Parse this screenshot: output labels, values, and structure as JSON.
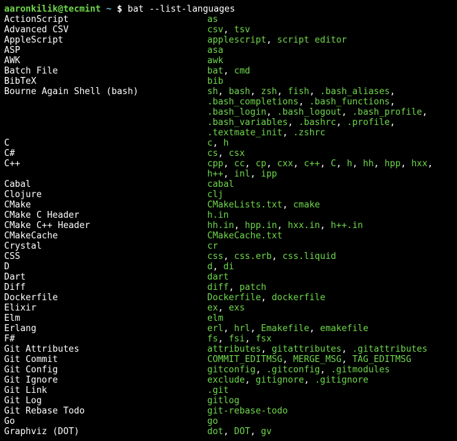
{
  "prompt": {
    "user": "aaronkilik@tecmint",
    "tilde": "~",
    "dollar": "$",
    "command": "bat --list-languages"
  },
  "rows": [
    {
      "lang": "ActionScript",
      "exts": [
        "as"
      ]
    },
    {
      "lang": "Advanced CSV",
      "exts": [
        "csv",
        "tsv"
      ]
    },
    {
      "lang": "AppleScript",
      "exts": [
        "applescript",
        "script editor"
      ]
    },
    {
      "lang": "ASP",
      "exts": [
        "asa"
      ]
    },
    {
      "lang": "AWK",
      "exts": [
        "awk"
      ]
    },
    {
      "lang": "Batch File",
      "exts": [
        "bat",
        "cmd"
      ]
    },
    {
      "lang": "BibTeX",
      "exts": [
        "bib"
      ]
    },
    {
      "lang": "Bourne Again Shell (bash)",
      "exts": [
        "sh",
        "bash",
        "zsh",
        "fish",
        ".bash_aliases",
        ".bash_completions",
        ".bash_functions",
        ".bash_login",
        ".bash_logout",
        ".bash_profile",
        ".bash_variables",
        ".bashrc",
        ".profile",
        ".textmate_init",
        ".zshrc"
      ]
    },
    {
      "lang": "C",
      "exts": [
        "c",
        "h"
      ]
    },
    {
      "lang": "C#",
      "exts": [
        "cs",
        "csx"
      ]
    },
    {
      "lang": "C++",
      "exts": [
        "cpp",
        "cc",
        "cp",
        "cxx",
        "c++",
        "C",
        "h",
        "hh",
        "hpp",
        "hxx",
        "h++",
        "inl",
        "ipp"
      ]
    },
    {
      "lang": "Cabal",
      "exts": [
        "cabal"
      ]
    },
    {
      "lang": "Clojure",
      "exts": [
        "clj"
      ]
    },
    {
      "lang": "CMake",
      "exts": [
        "CMakeLists.txt",
        "cmake"
      ]
    },
    {
      "lang": "CMake C Header",
      "exts": [
        "h.in"
      ]
    },
    {
      "lang": "CMake C++ Header",
      "exts": [
        "hh.in",
        "hpp.in",
        "hxx.in",
        "h++.in"
      ]
    },
    {
      "lang": "CMakeCache",
      "exts": [
        "CMakeCache.txt"
      ]
    },
    {
      "lang": "Crystal",
      "exts": [
        "cr"
      ]
    },
    {
      "lang": "CSS",
      "exts": [
        "css",
        "css.erb",
        "css.liquid"
      ]
    },
    {
      "lang": "D",
      "exts": [
        "d",
        "di"
      ]
    },
    {
      "lang": "Dart",
      "exts": [
        "dart"
      ]
    },
    {
      "lang": "Diff",
      "exts": [
        "diff",
        "patch"
      ]
    },
    {
      "lang": "Dockerfile",
      "exts": [
        "Dockerfile",
        "dockerfile"
      ]
    },
    {
      "lang": "Elixir",
      "exts": [
        "ex",
        "exs"
      ]
    },
    {
      "lang": "Elm",
      "exts": [
        "elm"
      ]
    },
    {
      "lang": "Erlang",
      "exts": [
        "erl",
        "hrl",
        "Emakefile",
        "emakefile"
      ]
    },
    {
      "lang": "F#",
      "exts": [
        "fs",
        "fsi",
        "fsx"
      ]
    },
    {
      "lang": "Git Attributes",
      "exts": [
        "attributes",
        "gitattributes",
        ".gitattributes"
      ]
    },
    {
      "lang": "Git Commit",
      "exts": [
        "COMMIT_EDITMSG",
        "MERGE_MSG",
        "TAG_EDITMSG"
      ]
    },
    {
      "lang": "Git Config",
      "exts": [
        "gitconfig",
        ".gitconfig",
        ".gitmodules"
      ]
    },
    {
      "lang": "Git Ignore",
      "exts": [
        "exclude",
        "gitignore",
        ".gitignore"
      ]
    },
    {
      "lang": "Git Link",
      "exts": [
        ".git"
      ]
    },
    {
      "lang": "Git Log",
      "exts": [
        "gitlog"
      ]
    },
    {
      "lang": "Git Rebase Todo",
      "exts": [
        "git-rebase-todo"
      ]
    },
    {
      "lang": "Go",
      "exts": [
        "go"
      ]
    },
    {
      "lang": "Graphviz (DOT)",
      "exts": [
        "dot",
        "DOT",
        "gv"
      ]
    }
  ]
}
